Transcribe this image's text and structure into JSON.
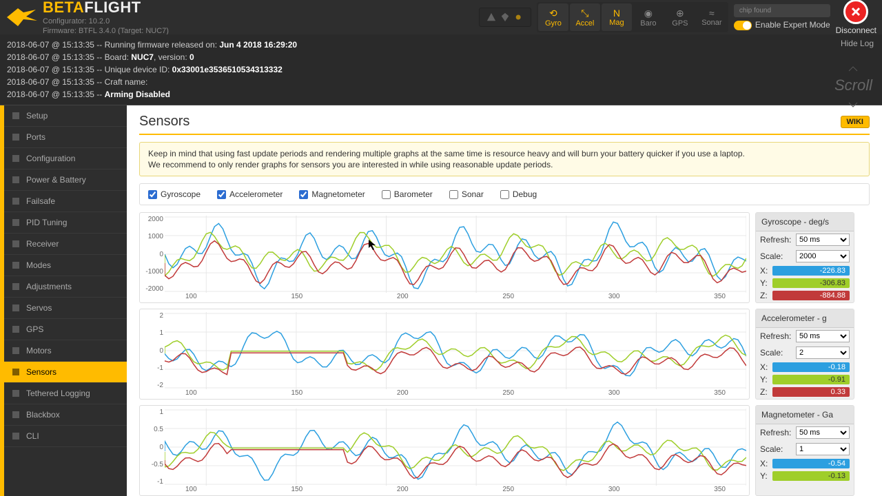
{
  "brand": {
    "a": "BETA",
    "b": "FLIGHT"
  },
  "brand_sub1": "Configurator: 10.2.0",
  "brand_sub2": "Firmware: BTFL 3.4.0 (Target: NUC7)",
  "sensors": [
    "Gyro",
    "Accel",
    "Mag",
    "Baro",
    "GPS",
    "Sonar"
  ],
  "sensors_on": [
    true,
    true,
    true,
    false,
    false,
    false
  ],
  "chip": "chip found",
  "expert": "Enable Expert Mode",
  "disconnect": "Disconnect",
  "hidelog": "Hide Log",
  "scroll": "Scroll",
  "log": [
    {
      "pre": "2018-06-07 @ 15:13:35 -- Running firmware released on: ",
      "b": "Jun 4 2018 16:29:20"
    },
    {
      "pre": "2018-06-07 @ 15:13:35 -- Board: ",
      "b": "NUC7",
      "mid": ", version: ",
      "b2": "0"
    },
    {
      "pre": "2018-06-07 @ 15:13:35 -- Unique device ID: ",
      "b": "0x33001e3536510534313332"
    },
    {
      "pre": "2018-06-07 @ 15:13:35 -- Craft name:",
      "b": ""
    },
    {
      "pre": "2018-06-07 @ 15:13:35 -- ",
      "b": "Arming Disabled"
    }
  ],
  "nav": [
    "Setup",
    "Ports",
    "Configuration",
    "Power & Battery",
    "Failsafe",
    "PID Tuning",
    "Receiver",
    "Modes",
    "Adjustments",
    "Servos",
    "GPS",
    "Motors",
    "Sensors",
    "Tethered Logging",
    "Blackbox",
    "CLI"
  ],
  "nav_active": "Sensors",
  "page": {
    "title": "Sensors",
    "wiki": "WIKI"
  },
  "note1": "Keep in mind that using fast update periods and rendering multiple graphs at the same time is resource heavy and will burn your battery quicker if you use a laptop.",
  "note2": "We recommend to only render graphs for sensors you are interested in while using reasonable update periods.",
  "checks": [
    {
      "label": "Gyroscope",
      "on": true
    },
    {
      "label": "Accelerometer",
      "on": true
    },
    {
      "label": "Magnetometer",
      "on": true
    },
    {
      "label": "Barometer",
      "on": false
    },
    {
      "label": "Sonar",
      "on": false
    },
    {
      "label": "Debug",
      "on": false
    }
  ],
  "labels": {
    "refresh": "Refresh:",
    "scale": "Scale:",
    "x": "X:",
    "y": "Y:",
    "z": "Z:"
  },
  "refresh_opt": "50 ms",
  "panels": [
    {
      "title": "Gyroscope - deg/s",
      "scale": "2000",
      "x": "-226.83",
      "y": "-306.83",
      "z": "-884.88"
    },
    {
      "title": "Accelerometer - g",
      "scale": "2",
      "x": "-0.18",
      "y": "-0.91",
      "z": "0.33"
    },
    {
      "title": "Magnetometer - Ga",
      "scale": "1",
      "x": "-0.54",
      "y": "-0.13"
    }
  ],
  "chart_data": [
    {
      "type": "line",
      "title": "Gyroscope - deg/s",
      "xlabel": "",
      "ylabel": "",
      "ylim": [
        -2000,
        2000
      ],
      "xlim": [
        75,
        375
      ],
      "yticks": [
        2000,
        1000,
        0,
        -1000,
        -2000
      ],
      "xticks": [
        100,
        150,
        200,
        250,
        300,
        350
      ],
      "series": [
        {
          "name": "X",
          "color": "#2c9fe0"
        },
        {
          "name": "Y",
          "color": "#9fce2a"
        },
        {
          "name": "Z",
          "color": "#c13a3a"
        }
      ]
    },
    {
      "type": "line",
      "title": "Accelerometer - g",
      "ylim": [
        -2,
        2
      ],
      "xlim": [
        75,
        375
      ],
      "yticks": [
        2,
        1,
        0,
        -1,
        -2
      ],
      "xticks": [
        100,
        150,
        200,
        250,
        300,
        350
      ],
      "series": [
        {
          "name": "X"
        },
        {
          "name": "Y"
        },
        {
          "name": "Z"
        }
      ]
    },
    {
      "type": "line",
      "title": "Magnetometer - Ga",
      "ylim": [
        -1,
        1
      ],
      "xlim": [
        75,
        375
      ],
      "yticks": [
        1,
        0.5,
        0,
        -0.5,
        -1
      ],
      "xticks": [
        100,
        150,
        200,
        250,
        300,
        350
      ],
      "series": [
        {
          "name": "X"
        },
        {
          "name": "Y"
        },
        {
          "name": "Z"
        }
      ]
    }
  ]
}
